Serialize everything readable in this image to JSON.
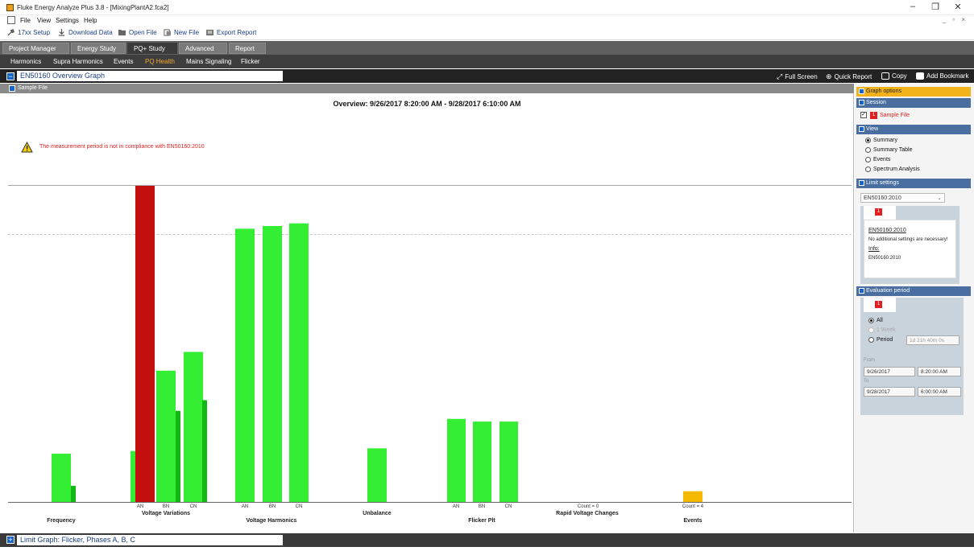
{
  "window": {
    "title": "Fluke Energy Analyze Plus 3.8 - [MixingPlantA2.fca2]",
    "minimize": "–",
    "restore": "❐",
    "close": "✕",
    "mdi_controls": "_ ▫ ×"
  },
  "menu": [
    "File",
    "View",
    "Settings",
    "Help"
  ],
  "toolbar": {
    "setup": "17xx Setup",
    "download": "Download Data",
    "open": "Open File",
    "new": "New File",
    "export": "Export Report"
  },
  "top_tabs": [
    "Project Manager",
    "Energy Study",
    "PQ+ Study",
    "Advanced",
    "Report"
  ],
  "active_top_tab": "PQ+ Study",
  "sub_tabs": [
    "Harmonics",
    "Supra Harmonics",
    "Events",
    "PQ Health",
    "Mains Signaling",
    "Flicker"
  ],
  "active_sub_tab": "PQ Health",
  "graph_bar": {
    "title": "EN50160 Overview Graph",
    "toggle": "−",
    "full_screen": "Full Screen",
    "quick_report": "Quick Report",
    "copy": "Copy",
    "add_bookmark": "Add Bookmark"
  },
  "plot": {
    "sample_label": "Sample File",
    "overview_title": "Overview: 9/26/2017 8:20:00 AM - 9/28/2017 6:10:00 AM",
    "warning": "The measurement period is not in compliance with EN50160:2010"
  },
  "chart_data": {
    "type": "bar",
    "ylim": [
      0,
      1.3
    ],
    "limit_line": 1.0,
    "colors": {
      "ok": "#33ee33",
      "ok_dark": "#14b814",
      "fail": "#c40f0f",
      "warn": "#f5b800"
    },
    "groups": [
      {
        "label": "Frequency",
        "bars": [
          {
            "value": 0.18,
            "color": "ok"
          },
          {
            "value": 0.06,
            "color": "ok_dark"
          }
        ],
        "phases": []
      },
      {
        "label": "Voltage Variations",
        "bars": [
          {
            "phase": "AN",
            "value": 0.19,
            "color": "ok"
          },
          {
            "phase": "AN",
            "value": 1.3,
            "color": "fail"
          },
          {
            "phase": "BN",
            "value": 0.49,
            "color": "ok"
          },
          {
            "phase": "BN",
            "value": 0.34,
            "color": "ok_dark"
          },
          {
            "phase": "CN",
            "value": 0.56,
            "color": "ok"
          },
          {
            "phase": "CN",
            "value": 0.38,
            "color": "ok_dark"
          }
        ],
        "phases": [
          "AN",
          "BN",
          "CN"
        ]
      },
      {
        "label": "Voltage Harmonics",
        "bars": [
          {
            "phase": "AN",
            "value": 1.02,
            "color": "ok"
          },
          {
            "phase": "BN",
            "value": 1.03,
            "color": "ok"
          },
          {
            "phase": "CN",
            "value": 1.04,
            "color": "ok"
          }
        ],
        "phases": [
          "AN",
          "BN",
          "CN"
        ]
      },
      {
        "label": "Unbalance",
        "bars": [
          {
            "value": 0.2,
            "color": "ok"
          }
        ],
        "phases": []
      },
      {
        "label": "Flicker Plt",
        "bars": [
          {
            "phase": "AN",
            "value": 0.31,
            "color": "ok"
          },
          {
            "phase": "BN",
            "value": 0.3,
            "color": "ok"
          },
          {
            "phase": "CN",
            "value": 0.3,
            "color": "ok"
          }
        ],
        "phases": [
          "AN",
          "BN",
          "CN"
        ]
      },
      {
        "label": "Rapid Voltage Changes",
        "bars": [],
        "count_label": "Count = 0"
      },
      {
        "label": "Events",
        "bars": [
          {
            "value": 0.04,
            "color": "warn"
          }
        ],
        "count_label": "Count = 4"
      }
    ]
  },
  "right_panel": {
    "graph_options": "Graph options",
    "session": "Session",
    "session_file": "Sample File",
    "session_badge": "1",
    "view": "View",
    "view_options": [
      "Summary",
      "Summary Table",
      "Events",
      "Spectrum Analysis"
    ],
    "view_selected": "Summary",
    "limit_settings": "Limit settings",
    "limit_selected": "EN50160:2010",
    "limit_badge": "1",
    "limit_name": "EN50160:2010",
    "limit_note": "No additional settings are necessary!",
    "info_label": "Info:",
    "info_value": "EN50160:2010",
    "evaluation_period": "Evaluation period",
    "eval_badge": "1",
    "eval_options": [
      "All",
      "1 Week",
      "Period"
    ],
    "eval_selected": "All",
    "period_value": "1d 21h 40m 0s",
    "from_label": "From",
    "from_date": "9/26/2017",
    "from_time": "8:20:00 AM",
    "to_label": "To",
    "to_date": "9/28/2017",
    "to_time": "6:00:00 AM"
  },
  "bottom_bar": {
    "toggle": "+",
    "title": "Limit Graph: Flicker, Phases A, B, C"
  }
}
